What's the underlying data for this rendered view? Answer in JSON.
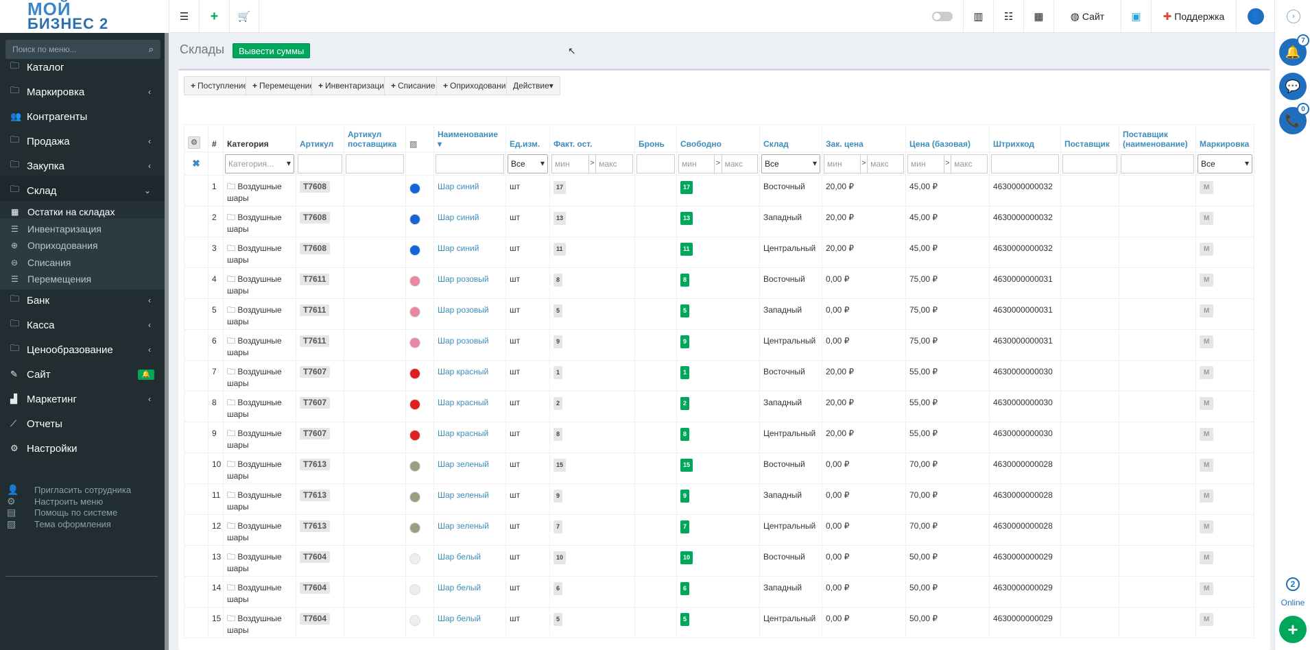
{
  "logo": {
    "line1": "МОЙ",
    "line2": "БИЗНЕС 2"
  },
  "topbar": {
    "site_label": "Сайт",
    "support_label": "Поддержка"
  },
  "sidebar": {
    "search_placeholder": "Поиск по меню...",
    "items": [
      {
        "label": "Каталог",
        "icon": "folder-icon",
        "chevron": false
      },
      {
        "label": "Маркировка",
        "icon": "folder-icon",
        "chevron": true
      },
      {
        "label": "Контрагенты",
        "icon": "users-icon",
        "chevron": false
      },
      {
        "label": "Продажа",
        "icon": "folder-icon",
        "chevron": true
      },
      {
        "label": "Закупка",
        "icon": "folder-icon",
        "chevron": true
      },
      {
        "label": "Склад",
        "icon": "folder-icon",
        "chevron": true
      }
    ],
    "sub_items": [
      {
        "label": "Остатки на складах",
        "icon": "grid-icon"
      },
      {
        "label": "Инвентаризация",
        "icon": "bars-icon"
      },
      {
        "label": "Оприходования",
        "icon": "plus-circle-icon"
      },
      {
        "label": "Списания",
        "icon": "minus-circle-icon"
      },
      {
        "label": "Перемещения",
        "icon": "bars-icon"
      }
    ],
    "items2": [
      {
        "label": "Банк",
        "icon": "folder-icon",
        "chevron": true
      },
      {
        "label": "Касса",
        "icon": "folder-icon",
        "chevron": true
      },
      {
        "label": "Ценообразование",
        "icon": "folder-icon",
        "chevron": true
      },
      {
        "label": "Сайт",
        "icon": "magic-icon",
        "chevron": false
      },
      {
        "label": "Маркетинг",
        "icon": "chart-icon",
        "chevron": true
      },
      {
        "label": "Отчеты",
        "icon": "line-chart-icon",
        "chevron": false
      },
      {
        "label": "Настройки",
        "icon": "gear-icon",
        "chevron": false
      }
    ],
    "footer": [
      {
        "label": "Пригласить сотрудника",
        "icon": "user-plus-icon"
      },
      {
        "label": "Настроить меню",
        "icon": "gears-icon"
      },
      {
        "label": "Помощь по системе",
        "icon": "book-icon"
      },
      {
        "label": "Тема оформления",
        "icon": "image-icon"
      }
    ]
  },
  "rail": {
    "notif_count": "7",
    "chat_count": "0",
    "online_count": "2",
    "online_label": "Online"
  },
  "page": {
    "title": "Склады",
    "sum_button": "Вывести суммы"
  },
  "actions": [
    "Поступление",
    "Перемещение",
    "Инвентаризация",
    "Списание",
    "Оприходование"
  ],
  "action_dropdown": "Действие",
  "columns": {
    "num": "#",
    "category": "Категория",
    "article": "Артикул",
    "supplier_article": "Артикул поставщика",
    "name": "Наименование",
    "unit": "Ед.изм.",
    "fact": "Факт. ост.",
    "reserve": "Бронь",
    "free": "Свободно",
    "warehouse": "Склад",
    "purchase_price": "Зак. цена",
    "base_price": "Цена (базовая)",
    "barcode": "Штрихкод",
    "supplier": "Поставщик",
    "supplier_name": "Поставщик (наименование)",
    "marking": "Маркировка"
  },
  "filters": {
    "category_placeholder": "Категория...",
    "all": "Все",
    "min": "мин",
    "max": "макс",
    "gt": ">"
  },
  "rows": [
    {
      "n": "1",
      "cat": "Воздушные шары",
      "art": "T7608",
      "color": "#1565d8",
      "name": "Шар синий",
      "unit": "шт",
      "fact": "17",
      "free": "17",
      "wh": "Восточный",
      "pp": "20,00 ₽",
      "bp": "45,00 ₽",
      "bc": "4630000000032",
      "mark": "M"
    },
    {
      "n": "2",
      "cat": "Воздушные шары",
      "art": "T7608",
      "color": "#1565d8",
      "name": "Шар синий",
      "unit": "шт",
      "fact": "13",
      "free": "13",
      "wh": "Западный",
      "pp": "20,00 ₽",
      "bp": "45,00 ₽",
      "bc": "4630000000032",
      "mark": "M"
    },
    {
      "n": "3",
      "cat": "Воздушные шары",
      "art": "T7608",
      "color": "#1565d8",
      "name": "Шар синий",
      "unit": "шт",
      "fact": "11",
      "free": "11",
      "wh": "Центральный",
      "pp": "20,00 ₽",
      "bp": "45,00 ₽",
      "bc": "4630000000032",
      "mark": "M"
    },
    {
      "n": "4",
      "cat": "Воздушные шары",
      "art": "T7611",
      "color": "#e889a4",
      "name": "Шар розовый",
      "unit": "шт",
      "fact": "8",
      "free": "8",
      "wh": "Восточный",
      "pp": "0,00 ₽",
      "bp": "75,00 ₽",
      "bc": "4630000000031",
      "mark": "M"
    },
    {
      "n": "5",
      "cat": "Воздушные шары",
      "art": "T7611",
      "color": "#e889a4",
      "name": "Шар розовый",
      "unit": "шт",
      "fact": "5",
      "free": "5",
      "wh": "Западный",
      "pp": "0,00 ₽",
      "bp": "75,00 ₽",
      "bc": "4630000000031",
      "mark": "M"
    },
    {
      "n": "6",
      "cat": "Воздушные шары",
      "art": "T7611",
      "color": "#e889a4",
      "name": "Шар розовый",
      "unit": "шт",
      "fact": "9",
      "free": "9",
      "wh": "Центральный",
      "pp": "0,00 ₽",
      "bp": "75,00 ₽",
      "bc": "4630000000031",
      "mark": "M"
    },
    {
      "n": "7",
      "cat": "Воздушные шары",
      "art": "T7607",
      "color": "#e02020",
      "name": "Шар красный",
      "unit": "шт",
      "fact": "1",
      "free": "1",
      "wh": "Восточный",
      "pp": "20,00 ₽",
      "bp": "55,00 ₽",
      "bc": "4630000000030",
      "mark": "M"
    },
    {
      "n": "8",
      "cat": "Воздушные шары",
      "art": "T7607",
      "color": "#e02020",
      "name": "Шар красный",
      "unit": "шт",
      "fact": "2",
      "free": "2",
      "wh": "Западный",
      "pp": "20,00 ₽",
      "bp": "55,00 ₽",
      "bc": "4630000000030",
      "mark": "M"
    },
    {
      "n": "9",
      "cat": "Воздушные шары",
      "art": "T7607",
      "color": "#e02020",
      "name": "Шар красный",
      "unit": "шт",
      "fact": "8",
      "free": "8",
      "wh": "Центральный",
      "pp": "20,00 ₽",
      "bp": "55,00 ₽",
      "bc": "4630000000030",
      "mark": "M"
    },
    {
      "n": "10",
      "cat": "Воздушные шары",
      "art": "T7613",
      "color": "#9a9e82",
      "name": "Шар зеленый",
      "unit": "шт",
      "fact": "15",
      "free": "15",
      "wh": "Восточный",
      "pp": "0,00 ₽",
      "bp": "70,00 ₽",
      "bc": "4630000000028",
      "mark": "M"
    },
    {
      "n": "11",
      "cat": "Воздушные шары",
      "art": "T7613",
      "color": "#9a9e82",
      "name": "Шар зеленый",
      "unit": "шт",
      "fact": "9",
      "free": "9",
      "wh": "Западный",
      "pp": "0,00 ₽",
      "bp": "70,00 ₽",
      "bc": "4630000000028",
      "mark": "M"
    },
    {
      "n": "12",
      "cat": "Воздушные шары",
      "art": "T7613",
      "color": "#9a9e82",
      "name": "Шар зеленый",
      "unit": "шт",
      "fact": "7",
      "free": "7",
      "wh": "Центральный",
      "pp": "0,00 ₽",
      "bp": "70,00 ₽",
      "bc": "4630000000028",
      "mark": "M"
    },
    {
      "n": "13",
      "cat": "Воздушные шары",
      "art": "T7604",
      "color": "#eeeeee",
      "name": "Шар белый",
      "unit": "шт",
      "fact": "10",
      "free": "10",
      "wh": "Восточный",
      "pp": "0,00 ₽",
      "bp": "50,00 ₽",
      "bc": "4630000000029",
      "mark": "M"
    },
    {
      "n": "14",
      "cat": "Воздушные шары",
      "art": "T7604",
      "color": "#eeeeee",
      "name": "Шар белый",
      "unit": "шт",
      "fact": "6",
      "free": "6",
      "wh": "Западный",
      "pp": "0,00 ₽",
      "bp": "50,00 ₽",
      "bc": "4630000000029",
      "mark": "M"
    },
    {
      "n": "15",
      "cat": "Воздушные шары",
      "art": "T7604",
      "color": "#eeeeee",
      "name": "Шар белый",
      "unit": "шт",
      "fact": "5",
      "free": "5",
      "wh": "Центральный",
      "pp": "0,00 ₽",
      "bp": "50,00 ₽",
      "bc": "4630000000029",
      "mark": "M"
    }
  ]
}
